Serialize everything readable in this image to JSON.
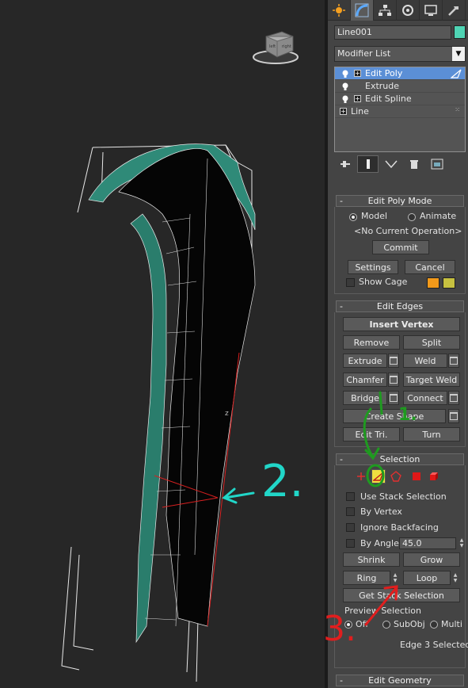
{
  "viewport": {
    "viewcube_left": "left",
    "viewcube_right": "right",
    "axis_label": "z"
  },
  "panel": {
    "command_tabs": [
      "create-icon",
      "modify-icon",
      "hierarchy-icon",
      "motion-icon",
      "display-icon",
      "utilities-icon"
    ],
    "object_name": "Line001",
    "object_color": "#4fd4b4",
    "modifier_list": "Modifier List",
    "stack": [
      {
        "label": "Edit Poly",
        "selected": true
      },
      {
        "label": "Extrude"
      },
      {
        "label": "Edit Spline"
      },
      {
        "label": "Line"
      }
    ]
  },
  "edit_poly_mode": {
    "title": "Edit Poly Mode",
    "model": "Model",
    "animate": "Animate",
    "status": "<No Current Operation>",
    "commit": "Commit",
    "settings": "Settings",
    "cancel": "Cancel",
    "show_cage": "Show Cage",
    "cage_colors": [
      "#f39a1a",
      "#c7c140"
    ]
  },
  "edit_edges": {
    "title": "Edit Edges",
    "insert_vertex": "Insert Vertex",
    "remove": "Remove",
    "split": "Split",
    "extrude": "Extrude",
    "weld": "Weld",
    "chamfer": "Chamfer",
    "target_weld": "Target Weld",
    "bridge": "Bridge",
    "connect": "Connect",
    "create_shape": "Create Shape",
    "edit_tri": "Edit Tri.",
    "turn": "Turn"
  },
  "selection": {
    "title": "Selection",
    "use_stack": "Use Stack Selection",
    "by_vertex": "By Vertex",
    "ignore_backfacing": "Ignore Backfacing",
    "by_angle": "By Angle:",
    "angle_value": "45.0",
    "shrink": "Shrink",
    "grow": "Grow",
    "ring": "Ring",
    "loop": "Loop",
    "get_stack": "Get Stack Selection",
    "preview": "Preview Selection",
    "off": "Off",
    "subobj": "SubObj",
    "multi": "Multi",
    "status": "Edge 3 Selected"
  },
  "edit_geometry": {
    "title": "Edit Geometry"
  },
  "annotations": {
    "one": "1.",
    "two": "2.",
    "three": "3."
  }
}
